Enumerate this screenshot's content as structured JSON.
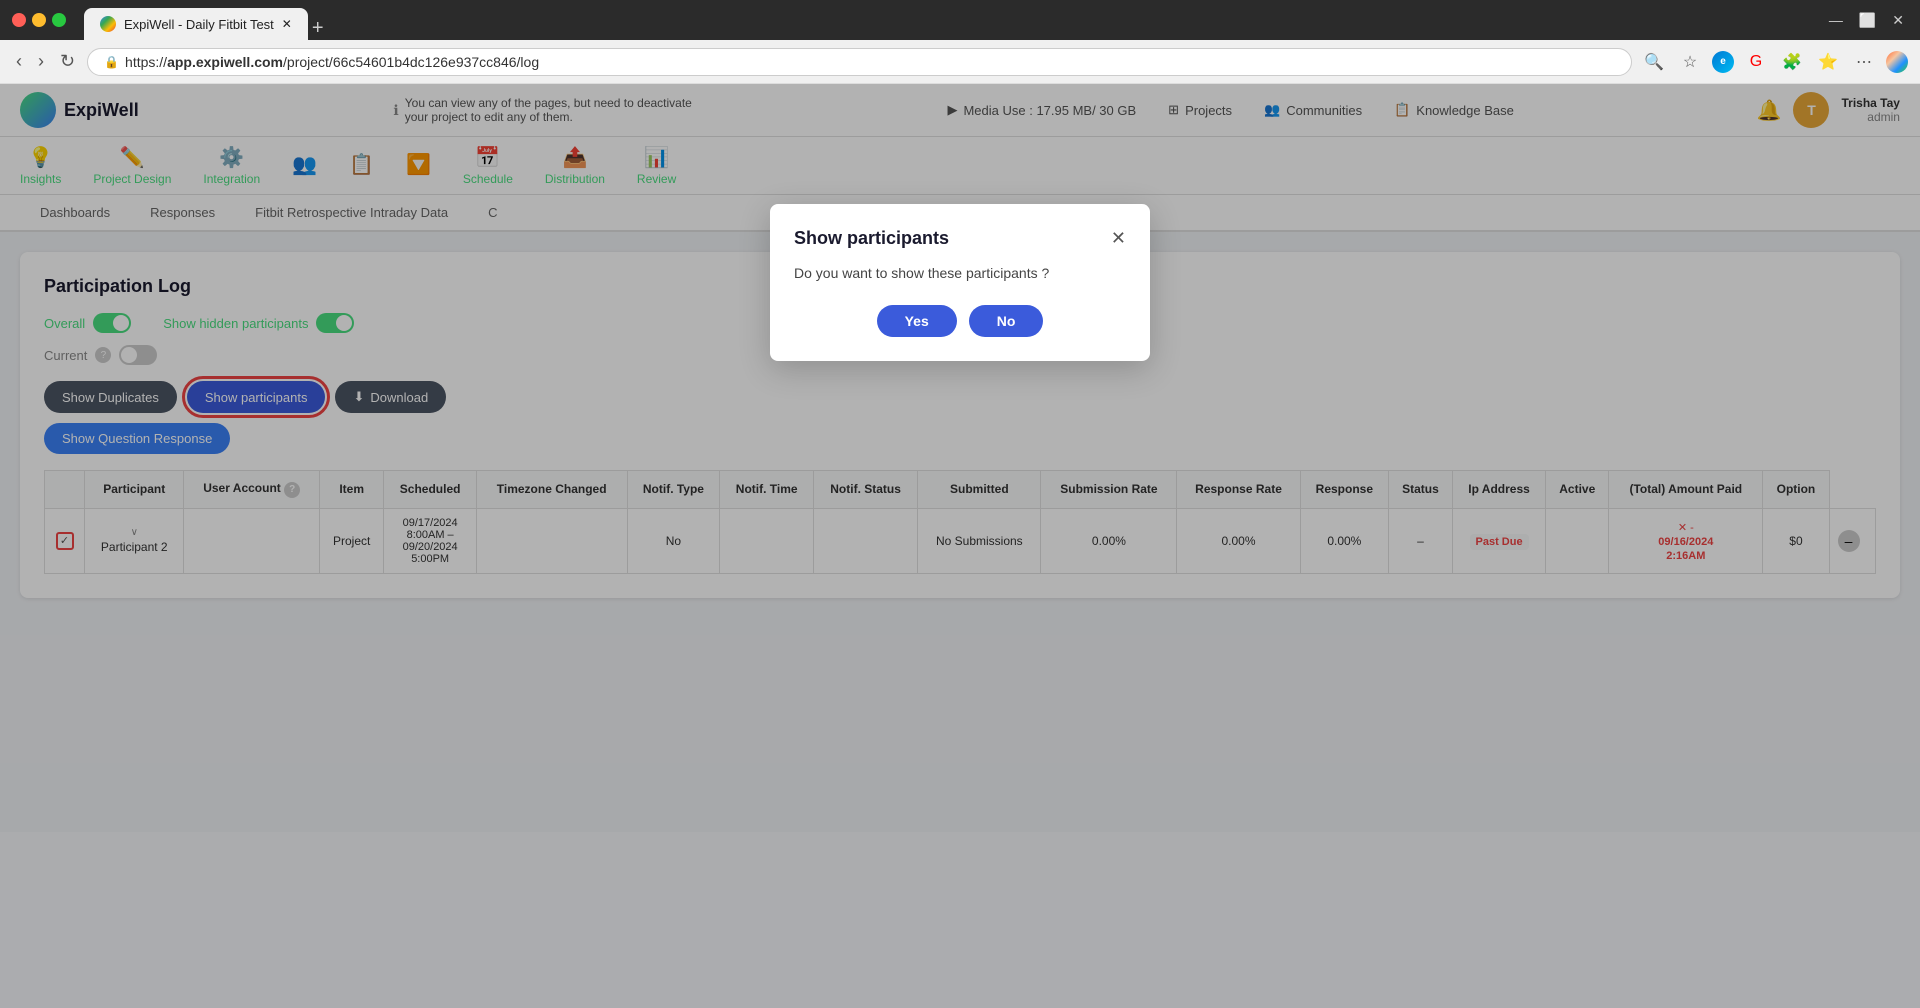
{
  "browser": {
    "tab_title": "ExpiWell - Daily Fitbit Test",
    "url_prefix": "https://",
    "url_domain": "app.expiwell.com",
    "url_path": "/project/66c54601b4dc126e937cc846/log",
    "new_tab_label": "+"
  },
  "app": {
    "logo_text": "ExpiWell",
    "info_message": "You can view any of the pages, but need to deactivate your project to edit any of them.",
    "media_use_label": "Media Use : 17.95 MB/ 30 GB",
    "top_nav": [
      {
        "icon": "▶",
        "label": "Media Use : 17.95 MB/ 30 GB"
      },
      {
        "icon": "⊞",
        "label": "Projects"
      },
      {
        "icon": "👥",
        "label": "Communities"
      },
      {
        "icon": "📋",
        "label": "Knowledge Base"
      }
    ],
    "user": {
      "name": "Trisha Tay",
      "role": "admin",
      "avatar_initials": "T"
    },
    "secondary_nav": [
      {
        "icon": "💡",
        "label": "Insights"
      },
      {
        "icon": "✏️",
        "label": "Project Design"
      },
      {
        "icon": "⚙️",
        "label": "Integration"
      },
      {
        "icon": "👥",
        "label": ""
      },
      {
        "icon": "📋",
        "label": ""
      },
      {
        "icon": "🔽",
        "label": ""
      },
      {
        "icon": "📅",
        "label": "Schedule"
      },
      {
        "icon": "📤",
        "label": "Distribution"
      },
      {
        "icon": "📊",
        "label": "Review"
      }
    ],
    "tabs": [
      {
        "label": "Dashboards",
        "active": false
      },
      {
        "label": "Responses",
        "active": false
      },
      {
        "label": "Fitbit Retrospective Intraday Data",
        "active": false
      },
      {
        "label": "C",
        "active": false
      }
    ],
    "page_title": "Participation Log",
    "toggles": [
      {
        "label": "Overall",
        "state": "on"
      },
      {
        "label": "Show hidden participants",
        "state": "on"
      },
      {
        "label": "Current",
        "state": "off"
      }
    ],
    "buttons": [
      {
        "label": "Show Duplicates",
        "type": "pill"
      },
      {
        "label": "Show participants",
        "type": "pill-highlight"
      },
      {
        "label": "Download",
        "type": "pill"
      },
      {
        "label": "Show Question Response",
        "type": "pill"
      }
    ],
    "table": {
      "columns": [
        "",
        "Participant",
        "User Account",
        "Item",
        "Scheduled",
        "Timezone Changed",
        "Notif. Type",
        "Notif. Time",
        "Notif. Status",
        "Submitted",
        "Submission Rate",
        "Response Rate",
        "Response",
        "Status",
        "Ip Address",
        "Active",
        "(Total) Amount Paid",
        "Option"
      ],
      "rows": [
        {
          "checkbox": true,
          "participant": "Participant 2",
          "user_account": "",
          "item": "Project",
          "scheduled": "09/17/2024 8:00AM – 09/20/2024 5:00PM",
          "timezone_changed": "",
          "notif_type": "No",
          "notif_time": "",
          "notif_status": "",
          "submitted": "No Submissions",
          "submission_rate": "0.00%",
          "response_rate": "0.00%",
          "response": "0.00%",
          "status_text": "–",
          "status_label": "Past Due",
          "ip_address": "",
          "active_icon": "✕",
          "active_date": "09/16/2024 2:16AM",
          "amount": "$0",
          "option": "–"
        }
      ]
    }
  },
  "modal": {
    "title": "Show participants",
    "body_text": "Do you want to show these participants ?",
    "yes_label": "Yes",
    "no_label": "No"
  }
}
